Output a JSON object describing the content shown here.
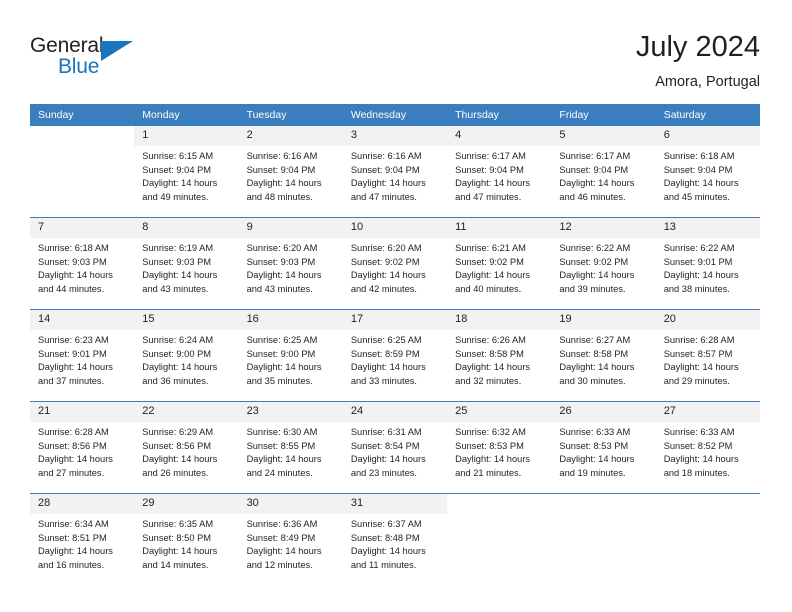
{
  "brand": {
    "name_part1": "General",
    "name_part2": "Blue"
  },
  "header": {
    "title": "July 2024",
    "location": "Amora, Portugal"
  },
  "colors": {
    "header_blue": "#3a7ebf",
    "brand_blue": "#1876bc",
    "day_band": "#f2f2f2",
    "text": "#231f20"
  },
  "weekday_headers": [
    "Sunday",
    "Monday",
    "Tuesday",
    "Wednesday",
    "Thursday",
    "Friday",
    "Saturday"
  ],
  "labels": {
    "sunrise_prefix": "Sunrise:",
    "sunset_prefix": "Sunset:",
    "daylight_prefix": "Daylight:"
  },
  "weeks": [
    [
      {
        "day": "",
        "sunrise": "",
        "sunset": "",
        "daylight": ""
      },
      {
        "day": "1",
        "sunrise": "Sunrise: 6:15 AM",
        "sunset": "Sunset: 9:04 PM",
        "daylight": "Daylight: 14 hours and 49 minutes."
      },
      {
        "day": "2",
        "sunrise": "Sunrise: 6:16 AM",
        "sunset": "Sunset: 9:04 PM",
        "daylight": "Daylight: 14 hours and 48 minutes."
      },
      {
        "day": "3",
        "sunrise": "Sunrise: 6:16 AM",
        "sunset": "Sunset: 9:04 PM",
        "daylight": "Daylight: 14 hours and 47 minutes."
      },
      {
        "day": "4",
        "sunrise": "Sunrise: 6:17 AM",
        "sunset": "Sunset: 9:04 PM",
        "daylight": "Daylight: 14 hours and 47 minutes."
      },
      {
        "day": "5",
        "sunrise": "Sunrise: 6:17 AM",
        "sunset": "Sunset: 9:04 PM",
        "daylight": "Daylight: 14 hours and 46 minutes."
      },
      {
        "day": "6",
        "sunrise": "Sunrise: 6:18 AM",
        "sunset": "Sunset: 9:04 PM",
        "daylight": "Daylight: 14 hours and 45 minutes."
      }
    ],
    [
      {
        "day": "7",
        "sunrise": "Sunrise: 6:18 AM",
        "sunset": "Sunset: 9:03 PM",
        "daylight": "Daylight: 14 hours and 44 minutes."
      },
      {
        "day": "8",
        "sunrise": "Sunrise: 6:19 AM",
        "sunset": "Sunset: 9:03 PM",
        "daylight": "Daylight: 14 hours and 43 minutes."
      },
      {
        "day": "9",
        "sunrise": "Sunrise: 6:20 AM",
        "sunset": "Sunset: 9:03 PM",
        "daylight": "Daylight: 14 hours and 43 minutes."
      },
      {
        "day": "10",
        "sunrise": "Sunrise: 6:20 AM",
        "sunset": "Sunset: 9:02 PM",
        "daylight": "Daylight: 14 hours and 42 minutes."
      },
      {
        "day": "11",
        "sunrise": "Sunrise: 6:21 AM",
        "sunset": "Sunset: 9:02 PM",
        "daylight": "Daylight: 14 hours and 40 minutes."
      },
      {
        "day": "12",
        "sunrise": "Sunrise: 6:22 AM",
        "sunset": "Sunset: 9:02 PM",
        "daylight": "Daylight: 14 hours and 39 minutes."
      },
      {
        "day": "13",
        "sunrise": "Sunrise: 6:22 AM",
        "sunset": "Sunset: 9:01 PM",
        "daylight": "Daylight: 14 hours and 38 minutes."
      }
    ],
    [
      {
        "day": "14",
        "sunrise": "Sunrise: 6:23 AM",
        "sunset": "Sunset: 9:01 PM",
        "daylight": "Daylight: 14 hours and 37 minutes."
      },
      {
        "day": "15",
        "sunrise": "Sunrise: 6:24 AM",
        "sunset": "Sunset: 9:00 PM",
        "daylight": "Daylight: 14 hours and 36 minutes."
      },
      {
        "day": "16",
        "sunrise": "Sunrise: 6:25 AM",
        "sunset": "Sunset: 9:00 PM",
        "daylight": "Daylight: 14 hours and 35 minutes."
      },
      {
        "day": "17",
        "sunrise": "Sunrise: 6:25 AM",
        "sunset": "Sunset: 8:59 PM",
        "daylight": "Daylight: 14 hours and 33 minutes."
      },
      {
        "day": "18",
        "sunrise": "Sunrise: 6:26 AM",
        "sunset": "Sunset: 8:58 PM",
        "daylight": "Daylight: 14 hours and 32 minutes."
      },
      {
        "day": "19",
        "sunrise": "Sunrise: 6:27 AM",
        "sunset": "Sunset: 8:58 PM",
        "daylight": "Daylight: 14 hours and 30 minutes."
      },
      {
        "day": "20",
        "sunrise": "Sunrise: 6:28 AM",
        "sunset": "Sunset: 8:57 PM",
        "daylight": "Daylight: 14 hours and 29 minutes."
      }
    ],
    [
      {
        "day": "21",
        "sunrise": "Sunrise: 6:28 AM",
        "sunset": "Sunset: 8:56 PM",
        "daylight": "Daylight: 14 hours and 27 minutes."
      },
      {
        "day": "22",
        "sunrise": "Sunrise: 6:29 AM",
        "sunset": "Sunset: 8:56 PM",
        "daylight": "Daylight: 14 hours and 26 minutes."
      },
      {
        "day": "23",
        "sunrise": "Sunrise: 6:30 AM",
        "sunset": "Sunset: 8:55 PM",
        "daylight": "Daylight: 14 hours and 24 minutes."
      },
      {
        "day": "24",
        "sunrise": "Sunrise: 6:31 AM",
        "sunset": "Sunset: 8:54 PM",
        "daylight": "Daylight: 14 hours and 23 minutes."
      },
      {
        "day": "25",
        "sunrise": "Sunrise: 6:32 AM",
        "sunset": "Sunset: 8:53 PM",
        "daylight": "Daylight: 14 hours and 21 minutes."
      },
      {
        "day": "26",
        "sunrise": "Sunrise: 6:33 AM",
        "sunset": "Sunset: 8:53 PM",
        "daylight": "Daylight: 14 hours and 19 minutes."
      },
      {
        "day": "27",
        "sunrise": "Sunrise: 6:33 AM",
        "sunset": "Sunset: 8:52 PM",
        "daylight": "Daylight: 14 hours and 18 minutes."
      }
    ],
    [
      {
        "day": "28",
        "sunrise": "Sunrise: 6:34 AM",
        "sunset": "Sunset: 8:51 PM",
        "daylight": "Daylight: 14 hours and 16 minutes."
      },
      {
        "day": "29",
        "sunrise": "Sunrise: 6:35 AM",
        "sunset": "Sunset: 8:50 PM",
        "daylight": "Daylight: 14 hours and 14 minutes."
      },
      {
        "day": "30",
        "sunrise": "Sunrise: 6:36 AM",
        "sunset": "Sunset: 8:49 PM",
        "daylight": "Daylight: 14 hours and 12 minutes."
      },
      {
        "day": "31",
        "sunrise": "Sunrise: 6:37 AM",
        "sunset": "Sunset: 8:48 PM",
        "daylight": "Daylight: 14 hours and 11 minutes."
      },
      {
        "day": "",
        "sunrise": "",
        "sunset": "",
        "daylight": ""
      },
      {
        "day": "",
        "sunrise": "",
        "sunset": "",
        "daylight": ""
      },
      {
        "day": "",
        "sunrise": "",
        "sunset": "",
        "daylight": ""
      }
    ]
  ]
}
